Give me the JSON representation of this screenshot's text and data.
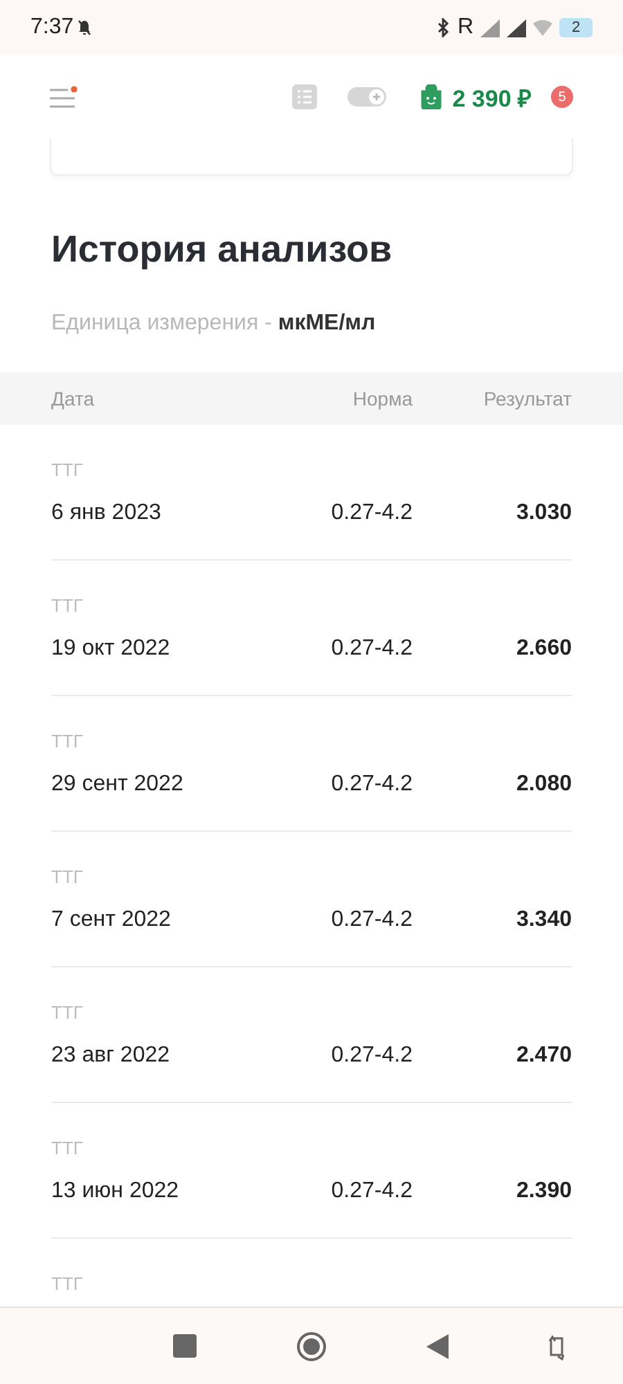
{
  "status_bar": {
    "time": "7:37",
    "network": "R",
    "battery": "2"
  },
  "header": {
    "menu_has_dot": true,
    "balance": "2 390 ₽",
    "notifications": "5"
  },
  "title": "История анализов",
  "unit": {
    "label": "Единица измерения - ",
    "value": "мкМЕ/мл"
  },
  "table": {
    "columns": [
      "Дата",
      "Норма",
      "Результат"
    ],
    "rows": [
      {
        "test": "ТТГ",
        "date": "6 янв 2023",
        "norm": "0.27-4.2",
        "result": "3.030"
      },
      {
        "test": "ТТГ",
        "date": "19 окт 2022",
        "norm": "0.27-4.2",
        "result": "2.660"
      },
      {
        "test": "ТТГ",
        "date": "29 сент 2022",
        "norm": "0.27-4.2",
        "result": "2.080"
      },
      {
        "test": "ТТГ",
        "date": "7 сент 2022",
        "norm": "0.27-4.2",
        "result": "3.340"
      },
      {
        "test": "ТТГ",
        "date": "23 авг 2022",
        "norm": "0.27-4.2",
        "result": "2.470"
      },
      {
        "test": "ТТГ",
        "date": "13 июн 2022",
        "norm": "0.27-4.2",
        "result": "2.390"
      },
      {
        "test": "ТТГ"
      }
    ]
  }
}
